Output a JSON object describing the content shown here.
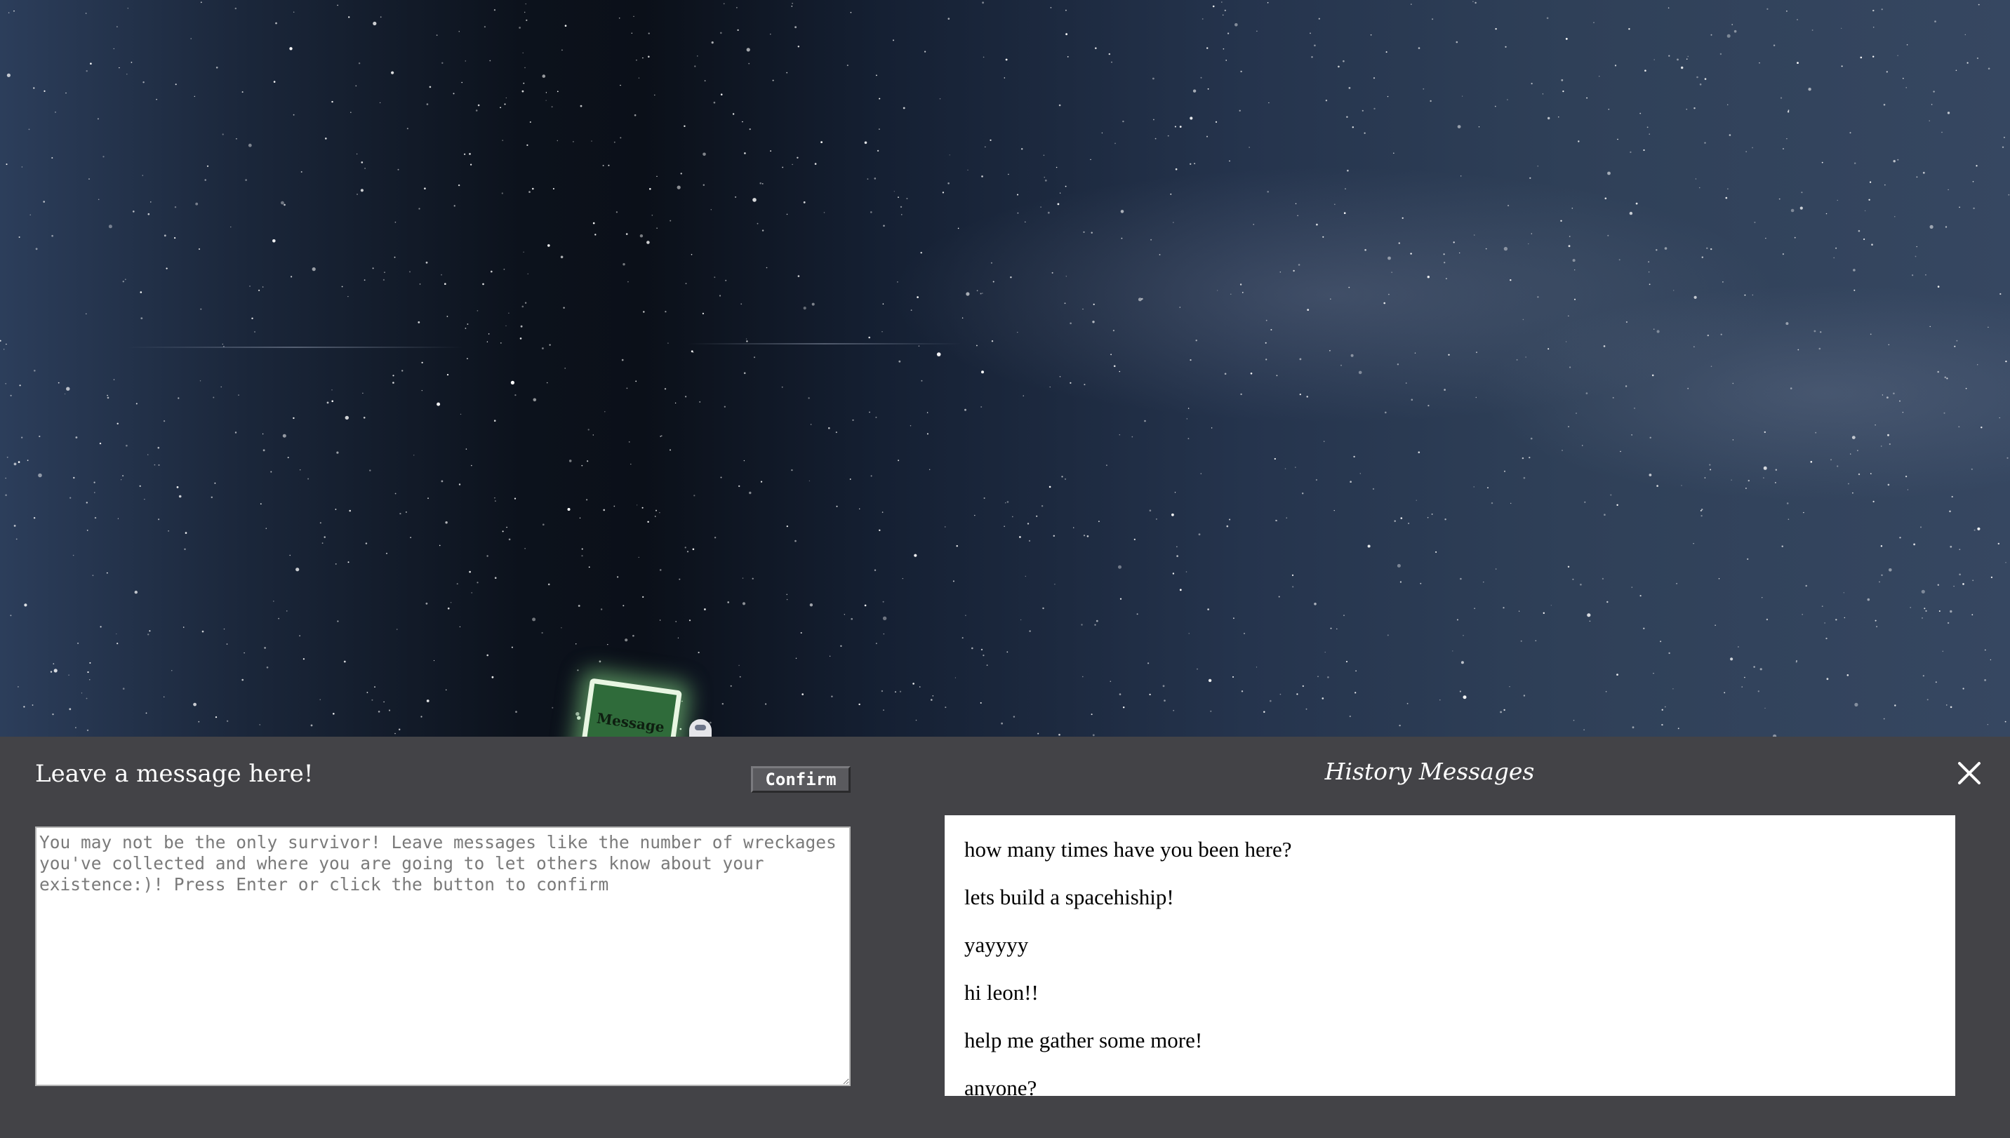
{
  "scene": {
    "mailbox_label": "Message"
  },
  "message_form": {
    "title": "Leave a message here!",
    "confirm_label": "Confirm",
    "placeholder": "You may not be the only survivor! Leave messages like the number of wreckages you've collected and where you are going to let others know about your existence:)! Press Enter or click the button to confirm",
    "value": ""
  },
  "history": {
    "title": "History Messages",
    "messages": [
      "how many times have you been here?",
      "lets build a spacehiship!",
      "yayyyy",
      "hi leon!!",
      "help me gather some more!",
      "anyone?"
    ]
  },
  "icons": {
    "close": "close-icon"
  },
  "colors": {
    "panel_bg": "#434347",
    "mailbox_glow": "#8ce68c",
    "sky_dark": "#0b1019",
    "sky_light": "#364761"
  }
}
